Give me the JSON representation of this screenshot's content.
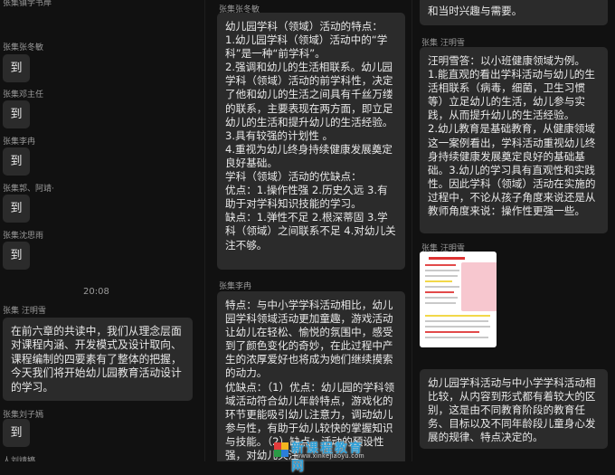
{
  "left": {
    "names": [
      "张集镇学书岸",
      "张集张冬敏",
      "张集邓主任",
      "张集李冉",
      "张集郭、阿靖·",
      "张集沈思雨",
      "张集 汪明雪",
      "张集刘子嫣",
      "人刘靖婷"
    ],
    "reply": "到",
    "time": "20:08",
    "long_message": "在前六章的共读中，我们从理念层面对课程内涵、开发模式及设计取向、课程编制的四要素有了整体的把握，今天我们将开始幼儿园教育活动设计的学习。"
  },
  "middle": {
    "name1": "张集张冬敏",
    "message1": "幼儿园学科（领域）活动的特点：\n1.幼儿园学科（领域）活动中的“学科”是一种“前学科”。\n2.强调和幼儿的生活相联系。幼儿园学科（领域）活动的前学科性，决定了他和幼儿的生活之间具有千丝万缕的联系，主要表现在两方面，即立足幼儿的生活和提升幼儿的生活经验。\n3.具有较强的计划性 。\n4.重视为幼儿终身持续健康发展奠定良好基础。\n学科（领域）活动的优缺点：\n优点：1.操作性强 2.历史久远 3.有助于对学科知识技能的学习。\n缺点：1.弹性不足 2.根深蒂固 3.学科（领域）之间联系不足 4.对幼儿关注不够。",
    "name2": "张集李冉",
    "message2": "特点：与中小学学科活动相比，幼儿园学科领域活动更加童趣，游戏活动让幼儿在轻松、愉悦的氛围中，感受到了颜色变化的奇妙，在此过程中产生的浓厚爱好也将成为她们继续摸索的动力。\n优缺点：（1）优点：幼儿园的学科领域活动符合幼儿年龄特点，游戏化的环节更能吸引幼儿注意力，调动幼儿参与性，有助于幼儿较快的掌握知识与技能。（2）缺点：活动的预设性强，对幼儿关注"
  },
  "right": {
    "message0": "和当时兴趣与需要。",
    "name1": "张集 汪明雪",
    "message1": "汪明雪答：以小班健康领域为例。\n1.能直观的看出学科活动与幼儿的生活相联系（病毒，细菌，卫生习惯等）立足幼儿的生活，幼儿参与实践，从而提升幼儿的生活经验。\n2.幼儿教育是基础教育，从健康领域这一案例看出，学科活动重视幼儿终身持续健康发展奠定良好的基础基础。3.幼儿的学习具有直观性和实践性。因此学科（领域）活动在实施的过程中，不论从孩子角度来说还是从教师角度来说：操作性更强一些。",
    "name2": "张集 汪明雪",
    "message2": "幼儿园学科活动与中小学学科活动相比较，从内容到形式都有着较大的区别，这是由不同教育阶段的教育任务、目标以及不同年龄段儿童身心发展的规律、特点决定的。"
  },
  "watermark": {
    "text": "新课程教育网",
    "url": "www.xinkejiaoyu.com",
    "colors": [
      "#e23b3b",
      "#f2b51f",
      "#2a9a45",
      "#2b7fd8"
    ]
  }
}
